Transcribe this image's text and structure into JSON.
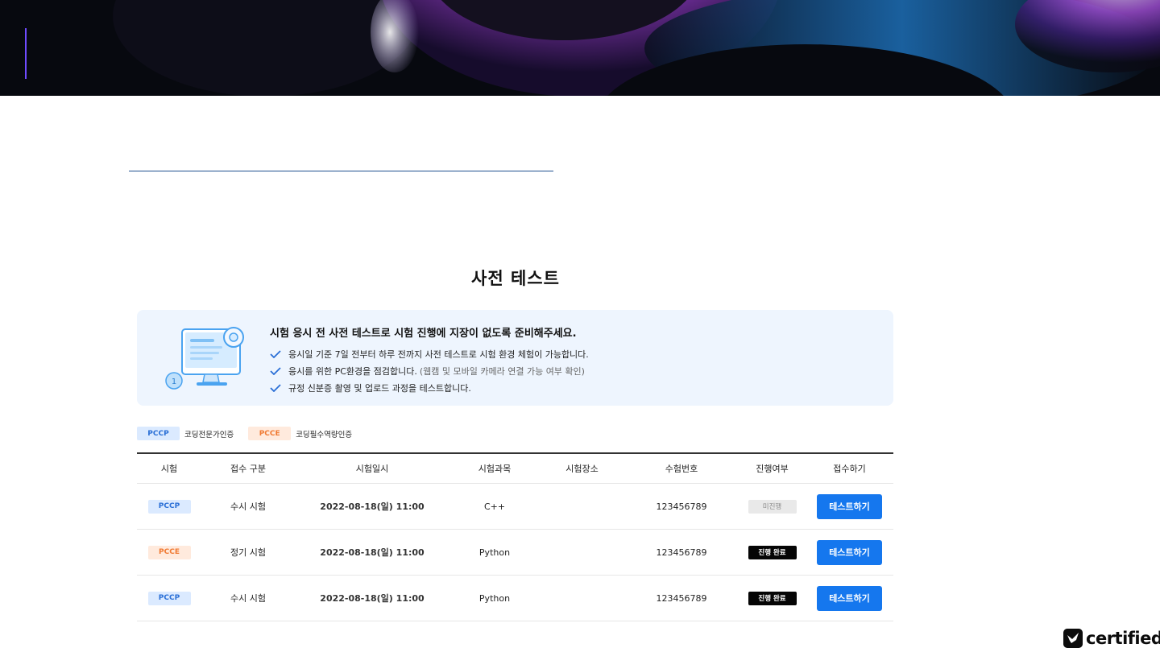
{
  "title": "사전 테스트",
  "notice": {
    "heading": "시험 응시 전 사전 테스트로 시험 진행에 지장이 없도록 준비해주세요.",
    "items": [
      {
        "text": "응시일 기준 7일 전부터 하루 전까지 사전 테스트로 시험 환경 체험이 가능합니다.",
        "note": ""
      },
      {
        "text": "응시를 위한 PC환경을 점검합니다.",
        "note": "(웹캠 및 모바일 카메라 연결 가능 여부 확인)"
      },
      {
        "text": "규정 신분증 촬영 및 업로드 과정을 테스트합니다.",
        "note": ""
      }
    ]
  },
  "legend": [
    {
      "tag": "PCCP",
      "desc": "코딩전문가인증"
    },
    {
      "tag": "PCCE",
      "desc": "코딩필수역량인증"
    }
  ],
  "table": {
    "headers": [
      "시험",
      "접수 구분",
      "시험일시",
      "시험과목",
      "시험장소",
      "수험번호",
      "진행여부",
      "접수하기"
    ],
    "rows": [
      {
        "exam": "PCCP",
        "type": "수시 시험",
        "datetime": "2022-08-18(일) 11:00",
        "subject": "C++",
        "place": "",
        "number": "123456789",
        "status": "미진행",
        "action": "테스트하기"
      },
      {
        "exam": "PCCE",
        "type": "정기 시험",
        "datetime": "2022-08-18(일) 11:00",
        "subject": "Python",
        "place": "",
        "number": "123456789",
        "status": "진행 완료",
        "action": "테스트하기"
      },
      {
        "exam": "PCCP",
        "type": "수시 시험",
        "datetime": "2022-08-18(일) 11:00",
        "subject": "Python",
        "place": "",
        "number": "123456789",
        "status": "진행 완료",
        "action": "테스트하기"
      }
    ]
  },
  "brand": {
    "name": "certified"
  },
  "colors": {
    "accent": "#1577ee",
    "pccp": "#2a6fd6",
    "pcce": "#f07a33",
    "notice_bg": "#eef5fe"
  }
}
